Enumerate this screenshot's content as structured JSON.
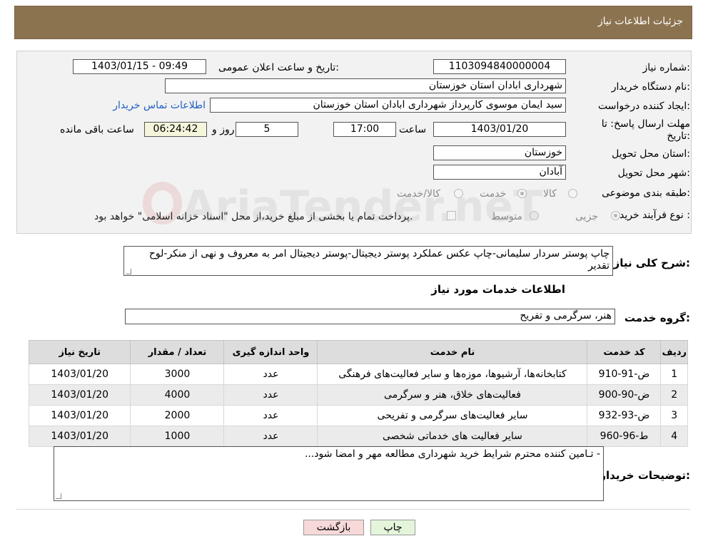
{
  "header": {
    "title": "جزئیات اطلاعات نیاز"
  },
  "form": {
    "need_number_label": "شماره نیاز:",
    "need_number": "1103094840000004",
    "announce_label": "تاریخ و ساعت اعلان عمومی:",
    "announce_value": "1403/01/15 - 09:49",
    "buyer_org_label": "نام دستگاه خریدار:",
    "buyer_org": "شهرداری ابادان استان خوزستان",
    "creator_label": "ایجاد کننده درخواست:",
    "creator": "سید ایمان موسوی کارپرداز شهرداری ابادان استان خوزستان",
    "contact_link": "اطلاعات تماس خریدار",
    "deadline_label_1": "مهلت ارسال پاسخ: تا",
    "deadline_label_2": "تاریخ:",
    "deadline_date": "1403/01/20",
    "time_label": "ساعت",
    "deadline_time": "17:00",
    "days_value": "5",
    "days_label": "روز و",
    "remaining_time": "06:24:42",
    "remaining_label": "ساعت باقی مانده",
    "province_label": "استان محل تحویل:",
    "province": "خوزستان",
    "city_label": "شهر محل تحویل:",
    "city": "آبادان",
    "category_label": "طبقه بندی موضوعی:",
    "category_options": [
      "کالا",
      "خدمت",
      "کالا/خدمت"
    ],
    "process_label": "نوع فرآیند خرید :",
    "process_options": [
      "جزیی",
      "متوسط"
    ],
    "payment_note": "پرداخت تمام یا بخشی از مبلغ خرید،از محل \"اسناد خزانه اسلامی\" خواهد بود."
  },
  "summary": {
    "label": "شرح کلی نیاز:",
    "text": "چاپ پوستر سردار سلیمانی-چاپ عکس عملکرد پوستر دیجیتال-پوستر دیجیتال امر به معروف و نهی از منکر-لوح تقدیر"
  },
  "services": {
    "section_title": "اطلاعات خدمات مورد نیاز",
    "group_label": "گروه خدمت:",
    "group_value": "هنر، سرگرمی و تفریح",
    "columns": [
      "ردیف",
      "کد خدمت",
      "نام خدمت",
      "واحد اندازه گیری",
      "تعداد / مقدار",
      "تاریخ نیاز"
    ],
    "rows": [
      [
        "1",
        "ض-91-910",
        "کتابخانه‌ها، آرشیوها، موزه‌ها و سایر فعالیت‌های فرهنگی",
        "عدد",
        "3000",
        "1403/01/20"
      ],
      [
        "2",
        "ض-90-900",
        "فعالیت‌های خلاق، هنر و سرگرمی",
        "عدد",
        "4000",
        "1403/01/20"
      ],
      [
        "3",
        "ض-93-932",
        "سایر فعالیت‌های سرگرمی و تفریحی",
        "عدد",
        "2000",
        "1403/01/20"
      ],
      [
        "4",
        "ط-96-960",
        "سایر فعالیت های خدماتی شخصی",
        "عدد",
        "1000",
        "1403/01/20"
      ]
    ]
  },
  "buyer_notes": {
    "label": "توضیحات خریدار:",
    "text": "- تـامین کننده محترم شرایط خرید شهرداری مطالعه مهر و امضا شود..."
  },
  "buttons": {
    "print": "چاپ",
    "back": "بازگشت"
  },
  "watermark": "AriaTender.neT",
  "colors": {
    "header_bg": "#8c7350",
    "panel_bg": "#f2f2f2",
    "link": "#1f5fc4",
    "back_btn": "#f7d9d9",
    "print_btn": "#e5f5dc"
  }
}
